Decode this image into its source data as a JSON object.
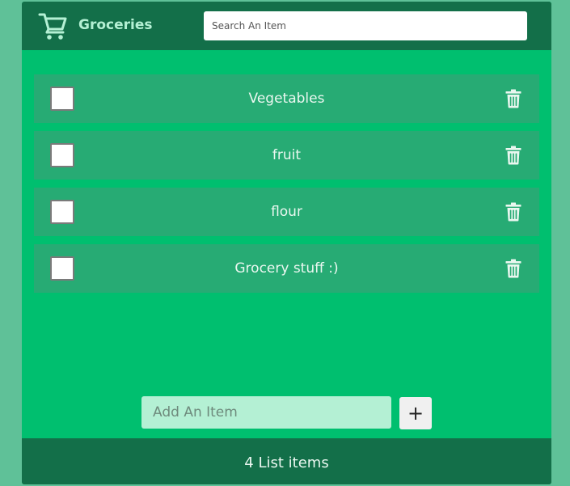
{
  "header": {
    "title": "Groceries",
    "icon": "shopping-cart-icon",
    "search_placeholder": "Search An Item"
  },
  "items": [
    {
      "label": "Vegetables",
      "checked": false
    },
    {
      "label": "fruit",
      "checked": false
    },
    {
      "label": "flour",
      "checked": false
    },
    {
      "label": "Grocery stuff :)",
      "checked": false
    }
  ],
  "add": {
    "placeholder": "Add An Item",
    "button_label": "+"
  },
  "footer": {
    "count_text": "4 List items"
  },
  "colors": {
    "page_bg": "#5fc198",
    "app_bg": "#00bf6f",
    "header_bg": "#136f49",
    "item_bg": "#27ab74",
    "accent_light": "#b4f0d4"
  }
}
